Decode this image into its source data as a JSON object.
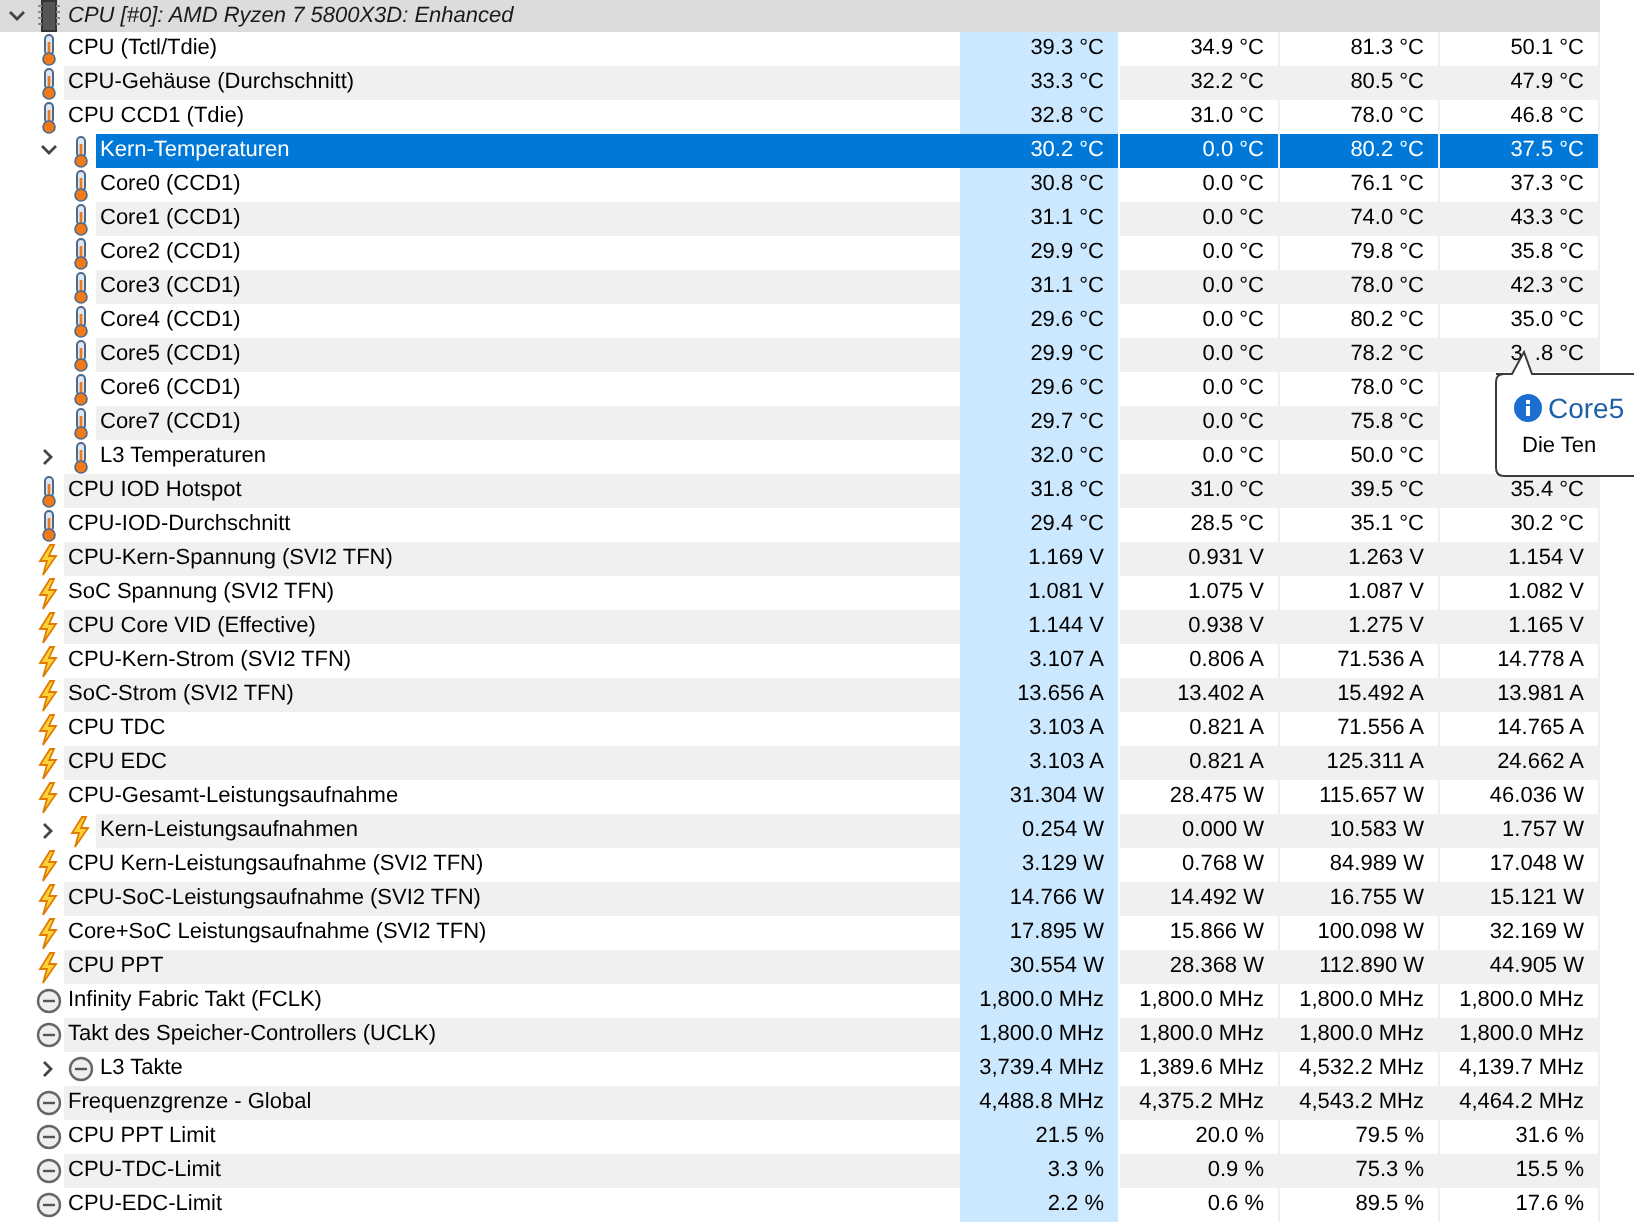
{
  "group": {
    "title": "CPU [#0]: AMD Ryzen 7 5800X3D: Enhanced",
    "expanded": true,
    "rows": [
      {
        "kind": "temperature",
        "label": "CPU (Tctl/Tdie)",
        "selected": false,
        "values": [
          "39.3 °C",
          "34.9 °C",
          "81.3 °C",
          "50.1 °C"
        ]
      },
      {
        "kind": "temperature",
        "label": "CPU-Gehäuse (Durchschnitt)",
        "selected": false,
        "values": [
          "33.3 °C",
          "32.2 °C",
          "80.5 °C",
          "47.9 °C"
        ]
      },
      {
        "kind": "temperature",
        "label": "CPU CCD1 (Tdie)",
        "selected": false,
        "values": [
          "32.8 °C",
          "31.0 °C",
          "78.0 °C",
          "46.8 °C"
        ]
      },
      {
        "kind": "temperature",
        "label": "Kern-Temperaturen",
        "selected": true,
        "expanded": true,
        "values": [
          "30.2 °C",
          "0.0 °C",
          "80.2 °C",
          "37.5 °C"
        ],
        "children": [
          {
            "kind": "temperature",
            "label": "Core0 (CCD1)",
            "selected": false,
            "values": [
              "30.8 °C",
              "0.0 °C",
              "76.1 °C",
              "37.3 °C"
            ]
          },
          {
            "kind": "temperature",
            "label": "Core1 (CCD1)",
            "selected": false,
            "values": [
              "31.1 °C",
              "0.0 °C",
              "74.0 °C",
              "43.3 °C"
            ]
          },
          {
            "kind": "temperature",
            "label": "Core2 (CCD1)",
            "selected": false,
            "values": [
              "29.9 °C",
              "0.0 °C",
              "79.8 °C",
              "35.8 °C"
            ]
          },
          {
            "kind": "temperature",
            "label": "Core3 (CCD1)",
            "selected": false,
            "values": [
              "31.1 °C",
              "0.0 °C",
              "78.0 °C",
              "42.3 °C"
            ]
          },
          {
            "kind": "temperature",
            "label": "Core4 (CCD1)",
            "selected": false,
            "values": [
              "29.6 °C",
              "0.0 °C",
              "80.2 °C",
              "35.0 °C"
            ]
          },
          {
            "kind": "temperature",
            "label": "Core5 (CCD1)",
            "selected": false,
            "values": [
              "29.9 °C",
              "0.0 °C",
              "78.2 °C",
              "3  .8 °C"
            ]
          },
          {
            "kind": "temperature",
            "label": "Core6 (CCD1)",
            "selected": false,
            "values": [
              "29.6 °C",
              "0.0 °C",
              "78.0 °C"
            ]
          },
          {
            "kind": "temperature",
            "label": "Core7 (CCD1)",
            "selected": false,
            "values": [
              "29.7 °C",
              "0.0 °C",
              "75.8 °C"
            ]
          }
        ]
      },
      {
        "kind": "temperature",
        "label": "L3 Temperaturen",
        "selected": false,
        "expanded": false,
        "values": [
          "32.0 °C",
          "0.0 °C",
          "50.0 °C"
        ]
      },
      {
        "kind": "temperature",
        "label": "CPU IOD Hotspot",
        "selected": false,
        "values": [
          "31.8 °C",
          "31.0 °C",
          "39.5 °C",
          "35.4 °C"
        ]
      },
      {
        "kind": "temperature",
        "label": "CPU-IOD-Durchschnitt",
        "selected": false,
        "values": [
          "29.4 °C",
          "28.5 °C",
          "35.1 °C",
          "30.2 °C"
        ]
      },
      {
        "kind": "power",
        "label": "CPU-Kern-Spannung (SVI2 TFN)",
        "selected": false,
        "values": [
          "1.169 V",
          "0.931 V",
          "1.263 V",
          "1.154 V"
        ]
      },
      {
        "kind": "power",
        "label": "SoC Spannung (SVI2 TFN)",
        "selected": false,
        "values": [
          "1.081 V",
          "1.075 V",
          "1.087 V",
          "1.082 V"
        ]
      },
      {
        "kind": "power",
        "label": "CPU Core VID (Effective)",
        "selected": false,
        "values": [
          "1.144 V",
          "0.938 V",
          "1.275 V",
          "1.165 V"
        ]
      },
      {
        "kind": "power",
        "label": "CPU-Kern-Strom (SVI2 TFN)",
        "selected": false,
        "values": [
          "3.107 A",
          "0.806 A",
          "71.536 A",
          "14.778 A"
        ]
      },
      {
        "kind": "power",
        "label": "SoC-Strom (SVI2 TFN)",
        "selected": false,
        "values": [
          "13.656 A",
          "13.402 A",
          "15.492 A",
          "13.981 A"
        ]
      },
      {
        "kind": "power",
        "label": "CPU TDC",
        "selected": false,
        "values": [
          "3.103 A",
          "0.821 A",
          "71.556 A",
          "14.765 A"
        ]
      },
      {
        "kind": "power",
        "label": "CPU EDC",
        "selected": false,
        "values": [
          "3.103 A",
          "0.821 A",
          "125.311 A",
          "24.662 A"
        ]
      },
      {
        "kind": "power",
        "label": "CPU-Gesamt-Leistungsaufnahme",
        "selected": false,
        "values": [
          "31.304 W",
          "28.475 W",
          "115.657 W",
          "46.036 W"
        ]
      },
      {
        "kind": "power",
        "label": "Kern-Leistungsaufnahmen",
        "selected": false,
        "expanded": false,
        "values": [
          "0.254 W",
          "0.000 W",
          "10.583 W",
          "1.757 W"
        ]
      },
      {
        "kind": "power",
        "label": "CPU Kern-Leistungsaufnahme (SVI2 TFN)",
        "selected": false,
        "values": [
          "3.129 W",
          "0.768 W",
          "84.989 W",
          "17.048 W"
        ]
      },
      {
        "kind": "power",
        "label": "CPU-SoC-Leistungsaufnahme (SVI2 TFN)",
        "selected": false,
        "values": [
          "14.766 W",
          "14.492 W",
          "16.755 W",
          "15.121 W"
        ]
      },
      {
        "kind": "power",
        "label": "Core+SoC Leistungsaufnahme (SVI2 TFN)",
        "selected": false,
        "values": [
          "17.895 W",
          "15.866 W",
          "100.098 W",
          "32.169 W"
        ]
      },
      {
        "kind": "power",
        "label": "CPU PPT",
        "selected": false,
        "values": [
          "30.554 W",
          "28.368 W",
          "112.890 W",
          "44.905 W"
        ]
      },
      {
        "kind": "clock",
        "label": "Infinity Fabric Takt (FCLK)",
        "selected": false,
        "values": [
          "1,800.0 MHz",
          "1,800.0 MHz",
          "1,800.0 MHz",
          "1,800.0 MHz"
        ]
      },
      {
        "kind": "clock",
        "label": "Takt des Speicher-Controllers (UCLK)",
        "selected": false,
        "values": [
          "1,800.0 MHz",
          "1,800.0 MHz",
          "1,800.0 MHz",
          "1,800.0 MHz"
        ]
      },
      {
        "kind": "clock",
        "label": "L3 Takte",
        "selected": false,
        "expanded": false,
        "values": [
          "3,739.4 MHz",
          "1,389.6 MHz",
          "4,532.2 MHz",
          "4,139.7 MHz"
        ]
      },
      {
        "kind": "clock",
        "label": "Frequenzgrenze - Global",
        "selected": false,
        "values": [
          "4,488.8 MHz",
          "4,375.2 MHz",
          "4,543.2 MHz",
          "4,464.2 MHz"
        ]
      },
      {
        "kind": "clock",
        "label": "CPU PPT Limit",
        "selected": false,
        "values": [
          "21.5 %",
          "20.0 %",
          "79.5 %",
          "31.6 %"
        ]
      },
      {
        "kind": "clock",
        "label": "CPU-TDC-Limit",
        "selected": false,
        "values": [
          "3.3 %",
          "0.9 %",
          "75.3 %",
          "15.5 %"
        ]
      },
      {
        "kind": "clock",
        "label": "CPU-EDC-Limit",
        "selected": false,
        "values": [
          "2.2 %",
          "0.6 %",
          "89.5 %",
          "17.6 %"
        ]
      }
    ]
  },
  "tooltip": {
    "title": "Core5",
    "text": "Die Ten"
  }
}
